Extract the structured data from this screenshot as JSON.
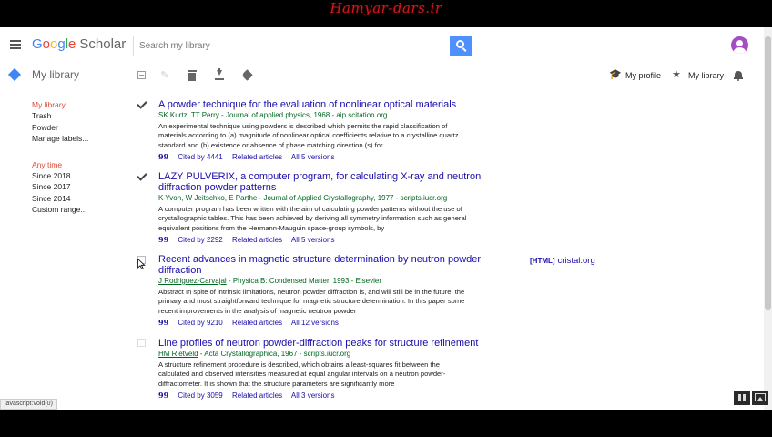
{
  "watermark": "Hamyar-dars.ir",
  "header": {
    "logo": {
      "g1": "G",
      "g2": "o",
      "g3": "o",
      "g4": "g",
      "g5": "l",
      "g6": "e",
      "scholar": "Scholar"
    },
    "search_placeholder": "Search my library"
  },
  "toolbar": {
    "title": "My library",
    "my_profile": "My profile",
    "my_library": "My library"
  },
  "sidebar": {
    "group1": [
      "My library",
      "Trash",
      "Powder",
      "Manage labels..."
    ],
    "group2": [
      "Any time",
      "Since 2018",
      "Since 2017",
      "Since 2014",
      "Custom range..."
    ]
  },
  "results": [
    {
      "checked": true,
      "title": "A powder technique for the evaluation of nonlinear optical materials",
      "authors_underlined": "",
      "authors": "SK Kurtz, TT Perry - Journal of applied physics, 1968 - aip.scitation.org",
      "abstract": "An experimental technique using powders is described which permits the rapid classification of materials according to (a) magnitude of nonlinear optical coefficients relative to a crystalline quartz standard and (b) existence or absence of phase matching direction (s) for",
      "cited": "Cited by 4441",
      "related": "Related articles",
      "versions": "All 5 versions"
    },
    {
      "checked": true,
      "title": "LAZY PULVERIX, a computer program, for calculating X-ray and neutron diffraction powder patterns",
      "authors_underlined": "",
      "authors": "K Yvon, W Jeitschko, E Parthe - Journal of Applied Crystallography, 1977 - scripts.iucr.org",
      "abstract": "A computer program has been written with the aim of calculating powder patterns without the use of crystallographic tables. This has been achieved by deriving all symmetry information such as general equivalent positions from the Hermann-Mauguin space-group symbols, by",
      "cited": "Cited by 2292",
      "related": "Related articles",
      "versions": "All 5 versions"
    },
    {
      "checked": false,
      "title": "Recent advances in magnetic structure determination by neutron powder diffraction",
      "authors_underlined": "J Rodriguez-Carvajal",
      "authors": " - Physica B: Condensed Matter, 1993 - Elsevier",
      "abstract": "Abstract In spite of intrinsic limitations, neutron powder diffraction is, and will still be in the future, the primary and most straightforward technique for magnetic structure determination. In this paper some recent improvements in the analysis of magnetic neutron powder",
      "cited": "Cited by 9210",
      "related": "Related articles",
      "versions": "All 12 versions",
      "side_tag": "[HTML]",
      "side_site": "cristal.org"
    },
    {
      "checked": false,
      "title": "Line profiles of neutron powder-diffraction peaks for structure refinement",
      "authors_underlined": "HM Rietveld",
      "authors": " - Acta Crystallographica, 1967 - scripts.iucr.org",
      "abstract": "A structure refinement procedure is described, which obtains a least-squares fit between the calculated and observed intensities measured at equal angular intervals on a neutron powder-diffractometer. It is shown that the structure parameters are significantly more",
      "cited": "Cited by 3059",
      "related": "Related articles",
      "versions": "All 3 versions"
    }
  ],
  "quote_glyph": "99",
  "status_bar": "javascript:void(0)",
  "icons": {
    "menu": "hamburger-icon",
    "search": "search-icon",
    "profile": "graduation-cap-icon",
    "library": "star-icon",
    "notifications": "bell-icon"
  },
  "colors": {
    "accent": "#4285f4",
    "search_button": "#4d90fe",
    "title_link": "#1a0dab",
    "authors": "#006621",
    "active_sidebar": "#dd4b39",
    "avatar": "#a54bc4"
  }
}
